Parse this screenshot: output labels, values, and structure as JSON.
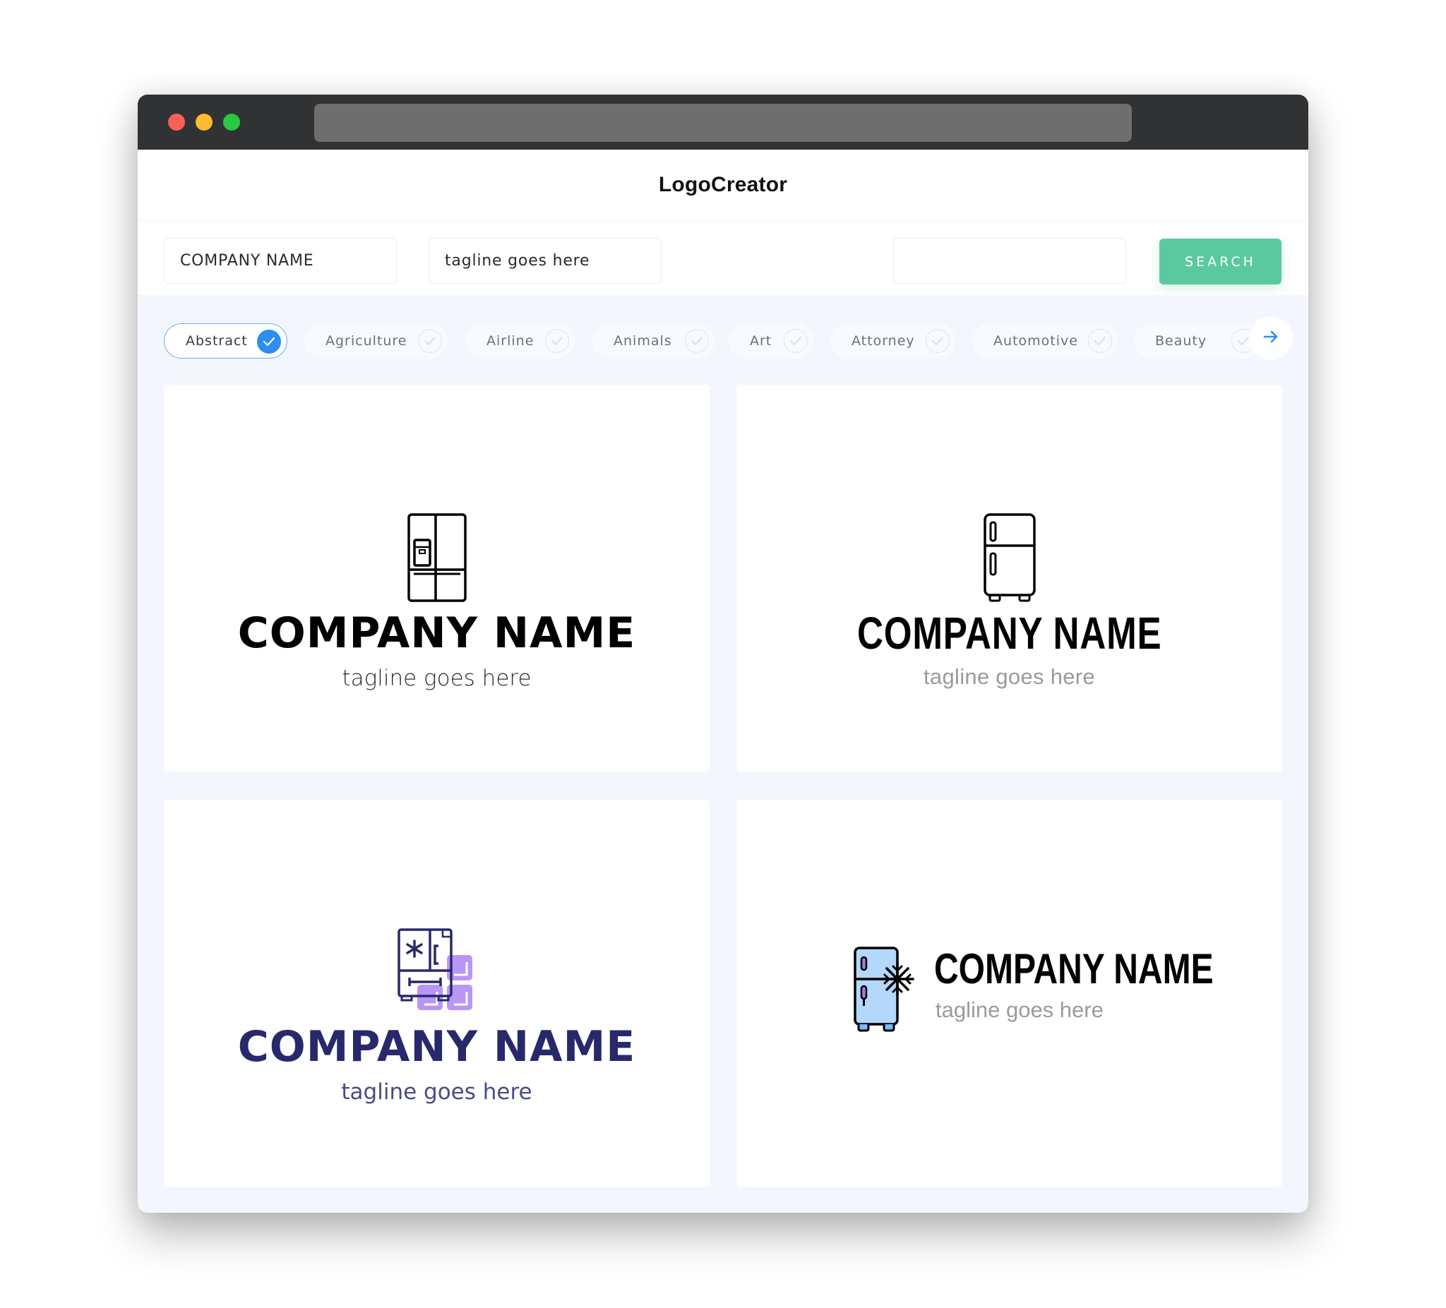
{
  "window": {
    "controls": [
      "close",
      "minimize",
      "maximize"
    ],
    "address_bar": ""
  },
  "header": {
    "title": "LogoCreator"
  },
  "search": {
    "company_name_value": "COMPANY NAME",
    "tagline_value": "tagline goes here",
    "keyword_value": "",
    "button_label": "SEARCH",
    "button_color": "#5bc9a0"
  },
  "categories": {
    "items": [
      {
        "label": "Abstract",
        "selected": true
      },
      {
        "label": "Agriculture",
        "selected": false
      },
      {
        "label": "Airline",
        "selected": false
      },
      {
        "label": "Animals",
        "selected": false
      },
      {
        "label": "Art",
        "selected": false
      },
      {
        "label": "Attorney",
        "selected": false
      },
      {
        "label": "Automotive",
        "selected": false
      },
      {
        "label": "Beauty",
        "selected": false
      }
    ],
    "next_icon": "arrow-right-icon",
    "accent_color": "#2b8ef0"
  },
  "logos": [
    {
      "icon": "french-door-refrigerator-icon",
      "company_name": "COMPANY NAME",
      "tagline": "tagline goes here",
      "text_color": "#000000",
      "layout": "stacked"
    },
    {
      "icon": "two-door-refrigerator-icon",
      "company_name": "COMPANY NAME",
      "tagline": "tagline goes here",
      "text_color": "#000000",
      "layout": "stacked"
    },
    {
      "icon": "refrigerator-ice-cubes-icon",
      "company_name": "COMPANY NAME",
      "tagline": "tagline goes here",
      "text_color": "#27296b",
      "layout": "stacked"
    },
    {
      "icon": "refrigerator-snowflake-icon",
      "company_name": "COMPANY NAME",
      "tagline": "tagline goes here",
      "text_color": "#000000",
      "layout": "inline"
    }
  ]
}
